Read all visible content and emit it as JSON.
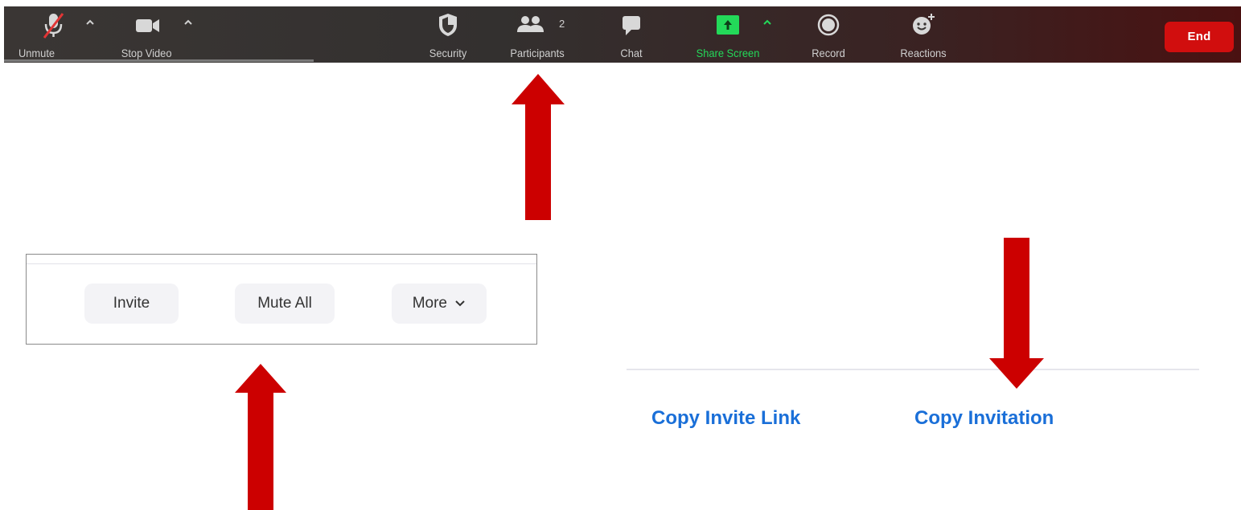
{
  "toolbar": {
    "unmute_label": "Unmute",
    "stop_video_label": "Stop Video",
    "security_label": "Security",
    "participants_label": "Participants",
    "participants_count": "2",
    "chat_label": "Chat",
    "share_screen_label": "Share Screen",
    "record_label": "Record",
    "reactions_label": "Reactions",
    "end_label": "End"
  },
  "participants_panel": {
    "invite_label": "Invite",
    "mute_all_label": "Mute All",
    "more_label": "More"
  },
  "invite_options": {
    "copy_invite_link_label": "Copy Invite Link",
    "copy_invitation_label": "Copy Invitation"
  },
  "colors": {
    "end_button": "#d10e0e",
    "share_screen_green": "#23d959",
    "link_blue": "#1a6fd8",
    "annotation_arrow": "#cc0000"
  }
}
